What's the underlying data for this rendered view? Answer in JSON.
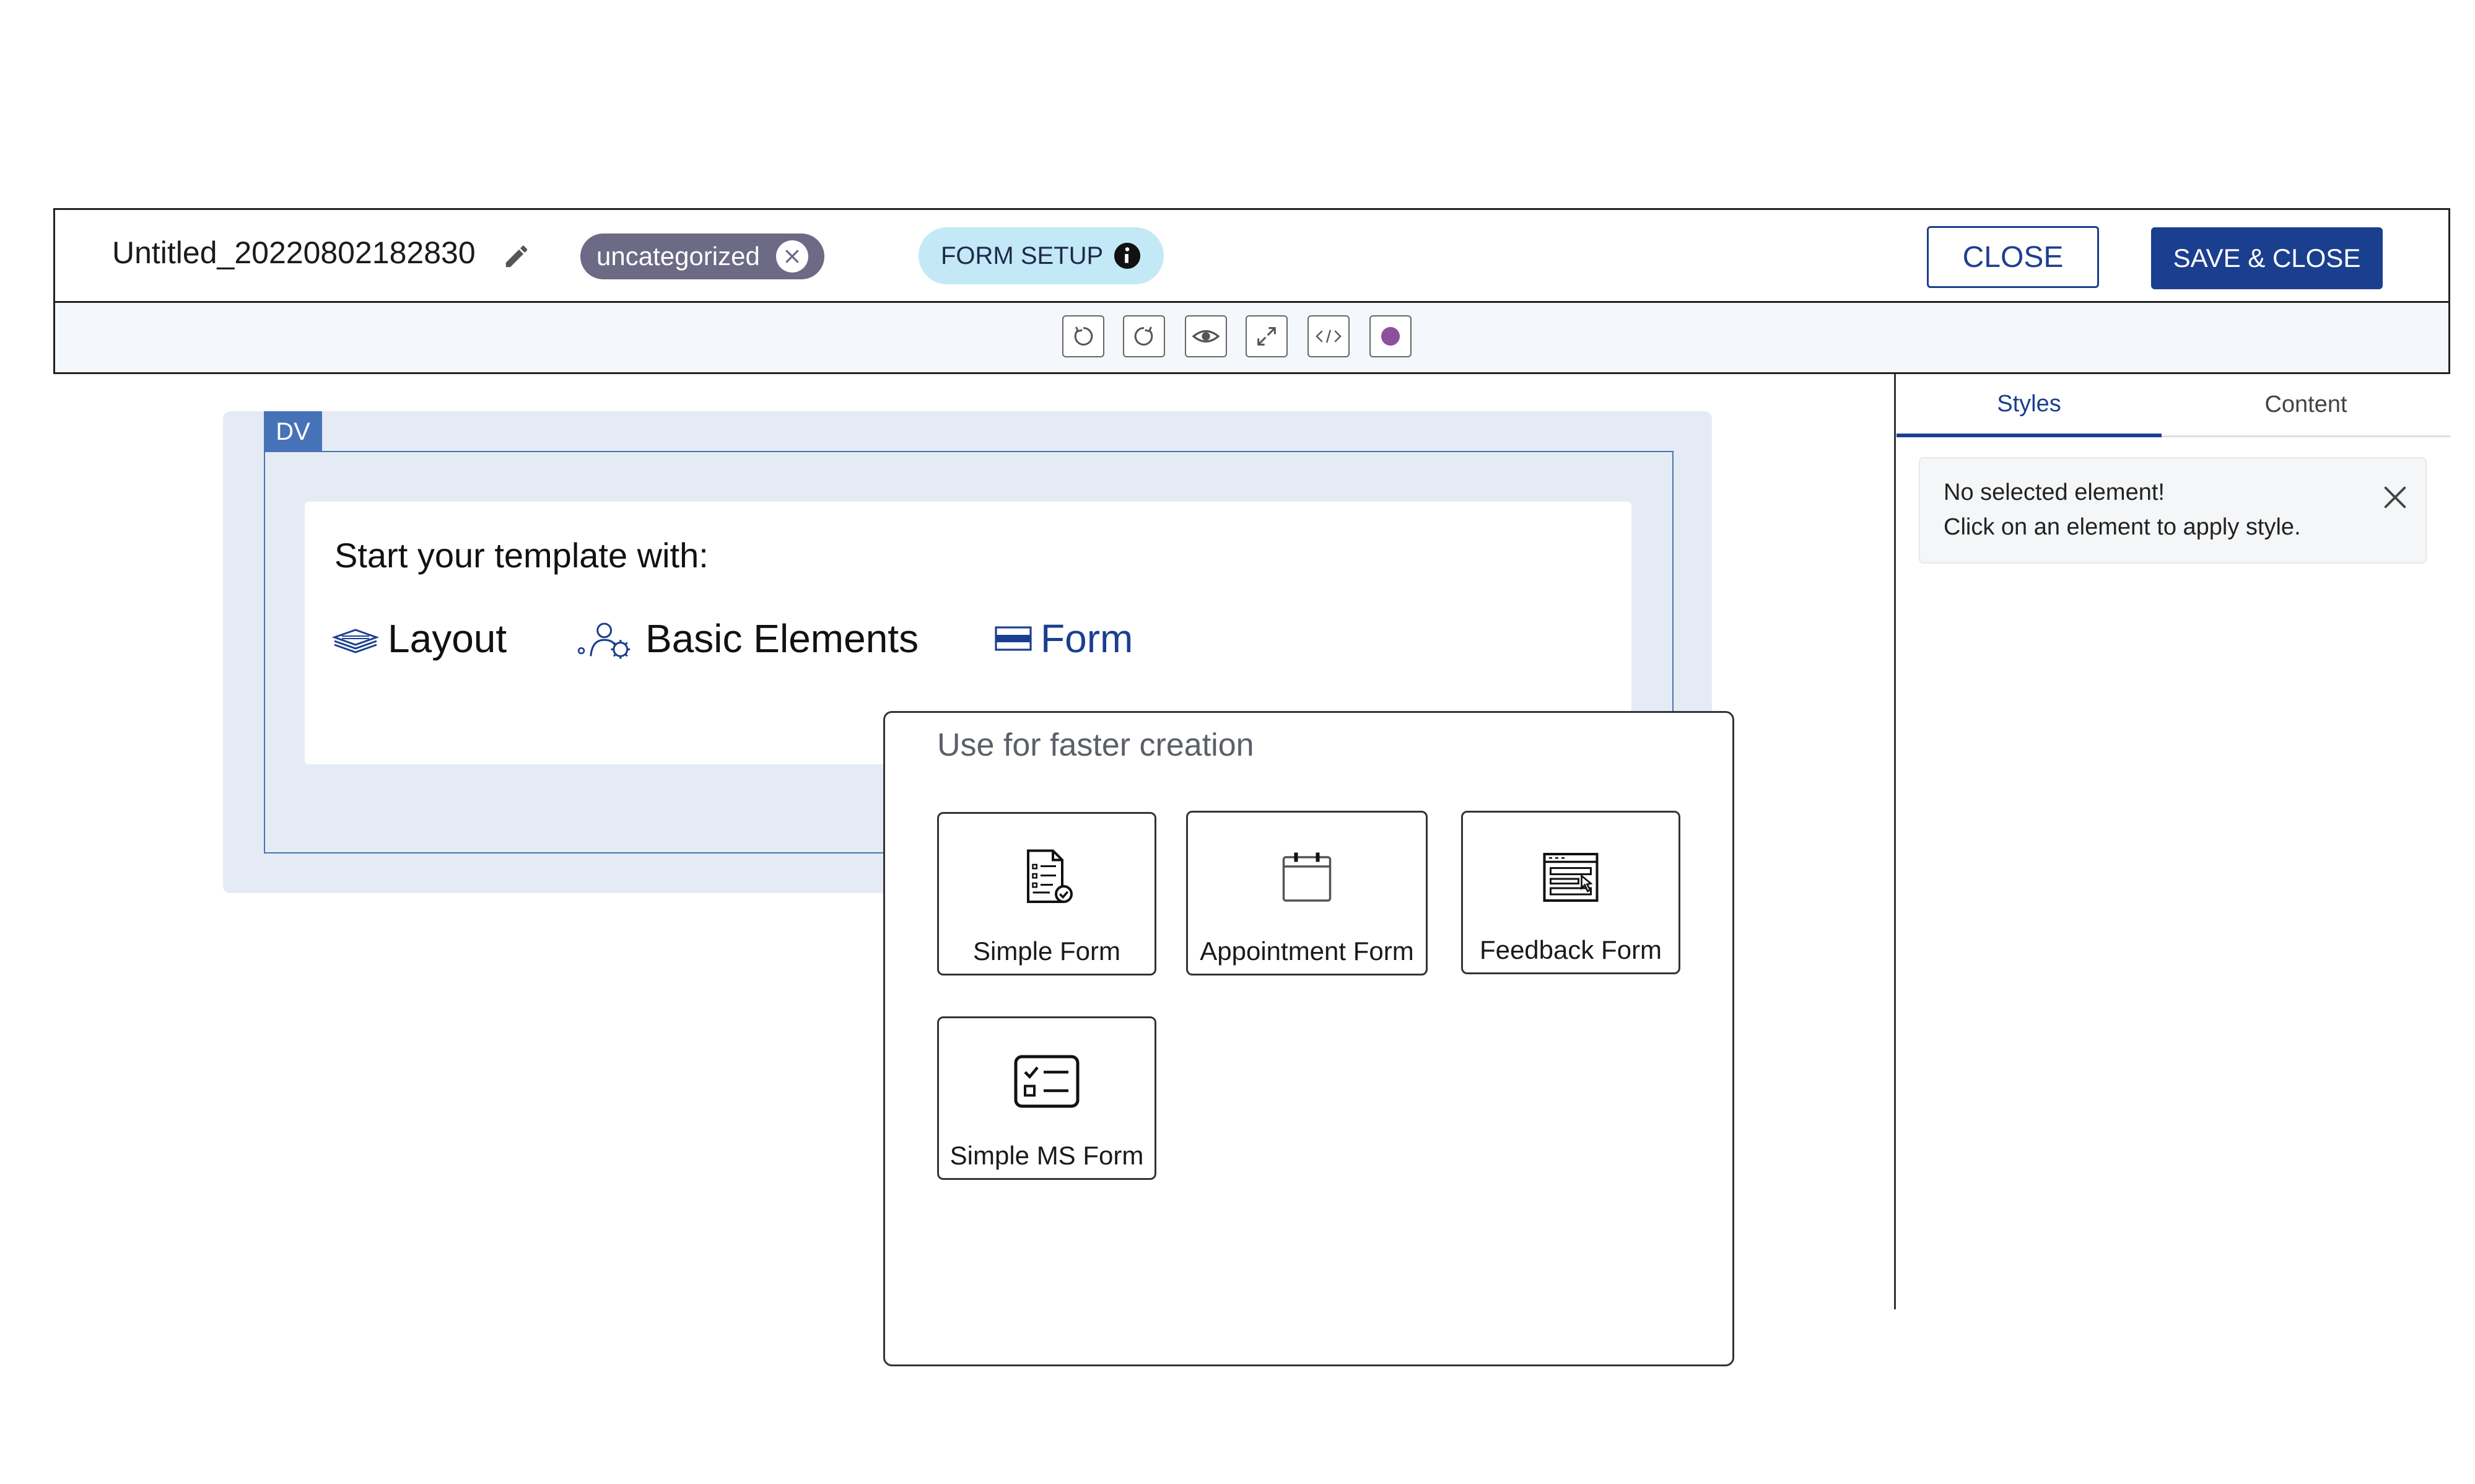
{
  "header": {
    "title": "Untitled_20220802182830",
    "category": "uncategorized",
    "form_setup": "FORM SETUP",
    "close_label": "CLOSE",
    "save_close_label": "SAVE & CLOSE"
  },
  "toolbar": {
    "buttons": [
      "undo-icon",
      "redo-icon",
      "preview-icon",
      "fullscreen-icon",
      "code-icon",
      "color-icon"
    ]
  },
  "canvas": {
    "block_label": "DV",
    "start_text": "Start your template with:",
    "options": {
      "layout": "Layout",
      "basic_elements": "Basic Elements",
      "form": "Form"
    }
  },
  "popup": {
    "title": "Use for faster creation",
    "templates": {
      "simple_form": "Simple Form",
      "appointment_form": "Appointment Form",
      "feedback_form": "Feedback Form",
      "simple_ms_form": "Simple MS Form"
    }
  },
  "panel": {
    "tabs": {
      "styles": "Styles",
      "content": "Content"
    },
    "notice": {
      "line1": "No selected element!",
      "line2": "Click on an element to apply style."
    }
  },
  "colors": {
    "primary": "#1b3f8f",
    "chip": "#6c6a85",
    "form_setup_bg": "#c3e9f7",
    "canvas_bg": "#e5ebf5",
    "dv_accent": "#4672b8",
    "color_swatch": "#8e4f9c"
  }
}
